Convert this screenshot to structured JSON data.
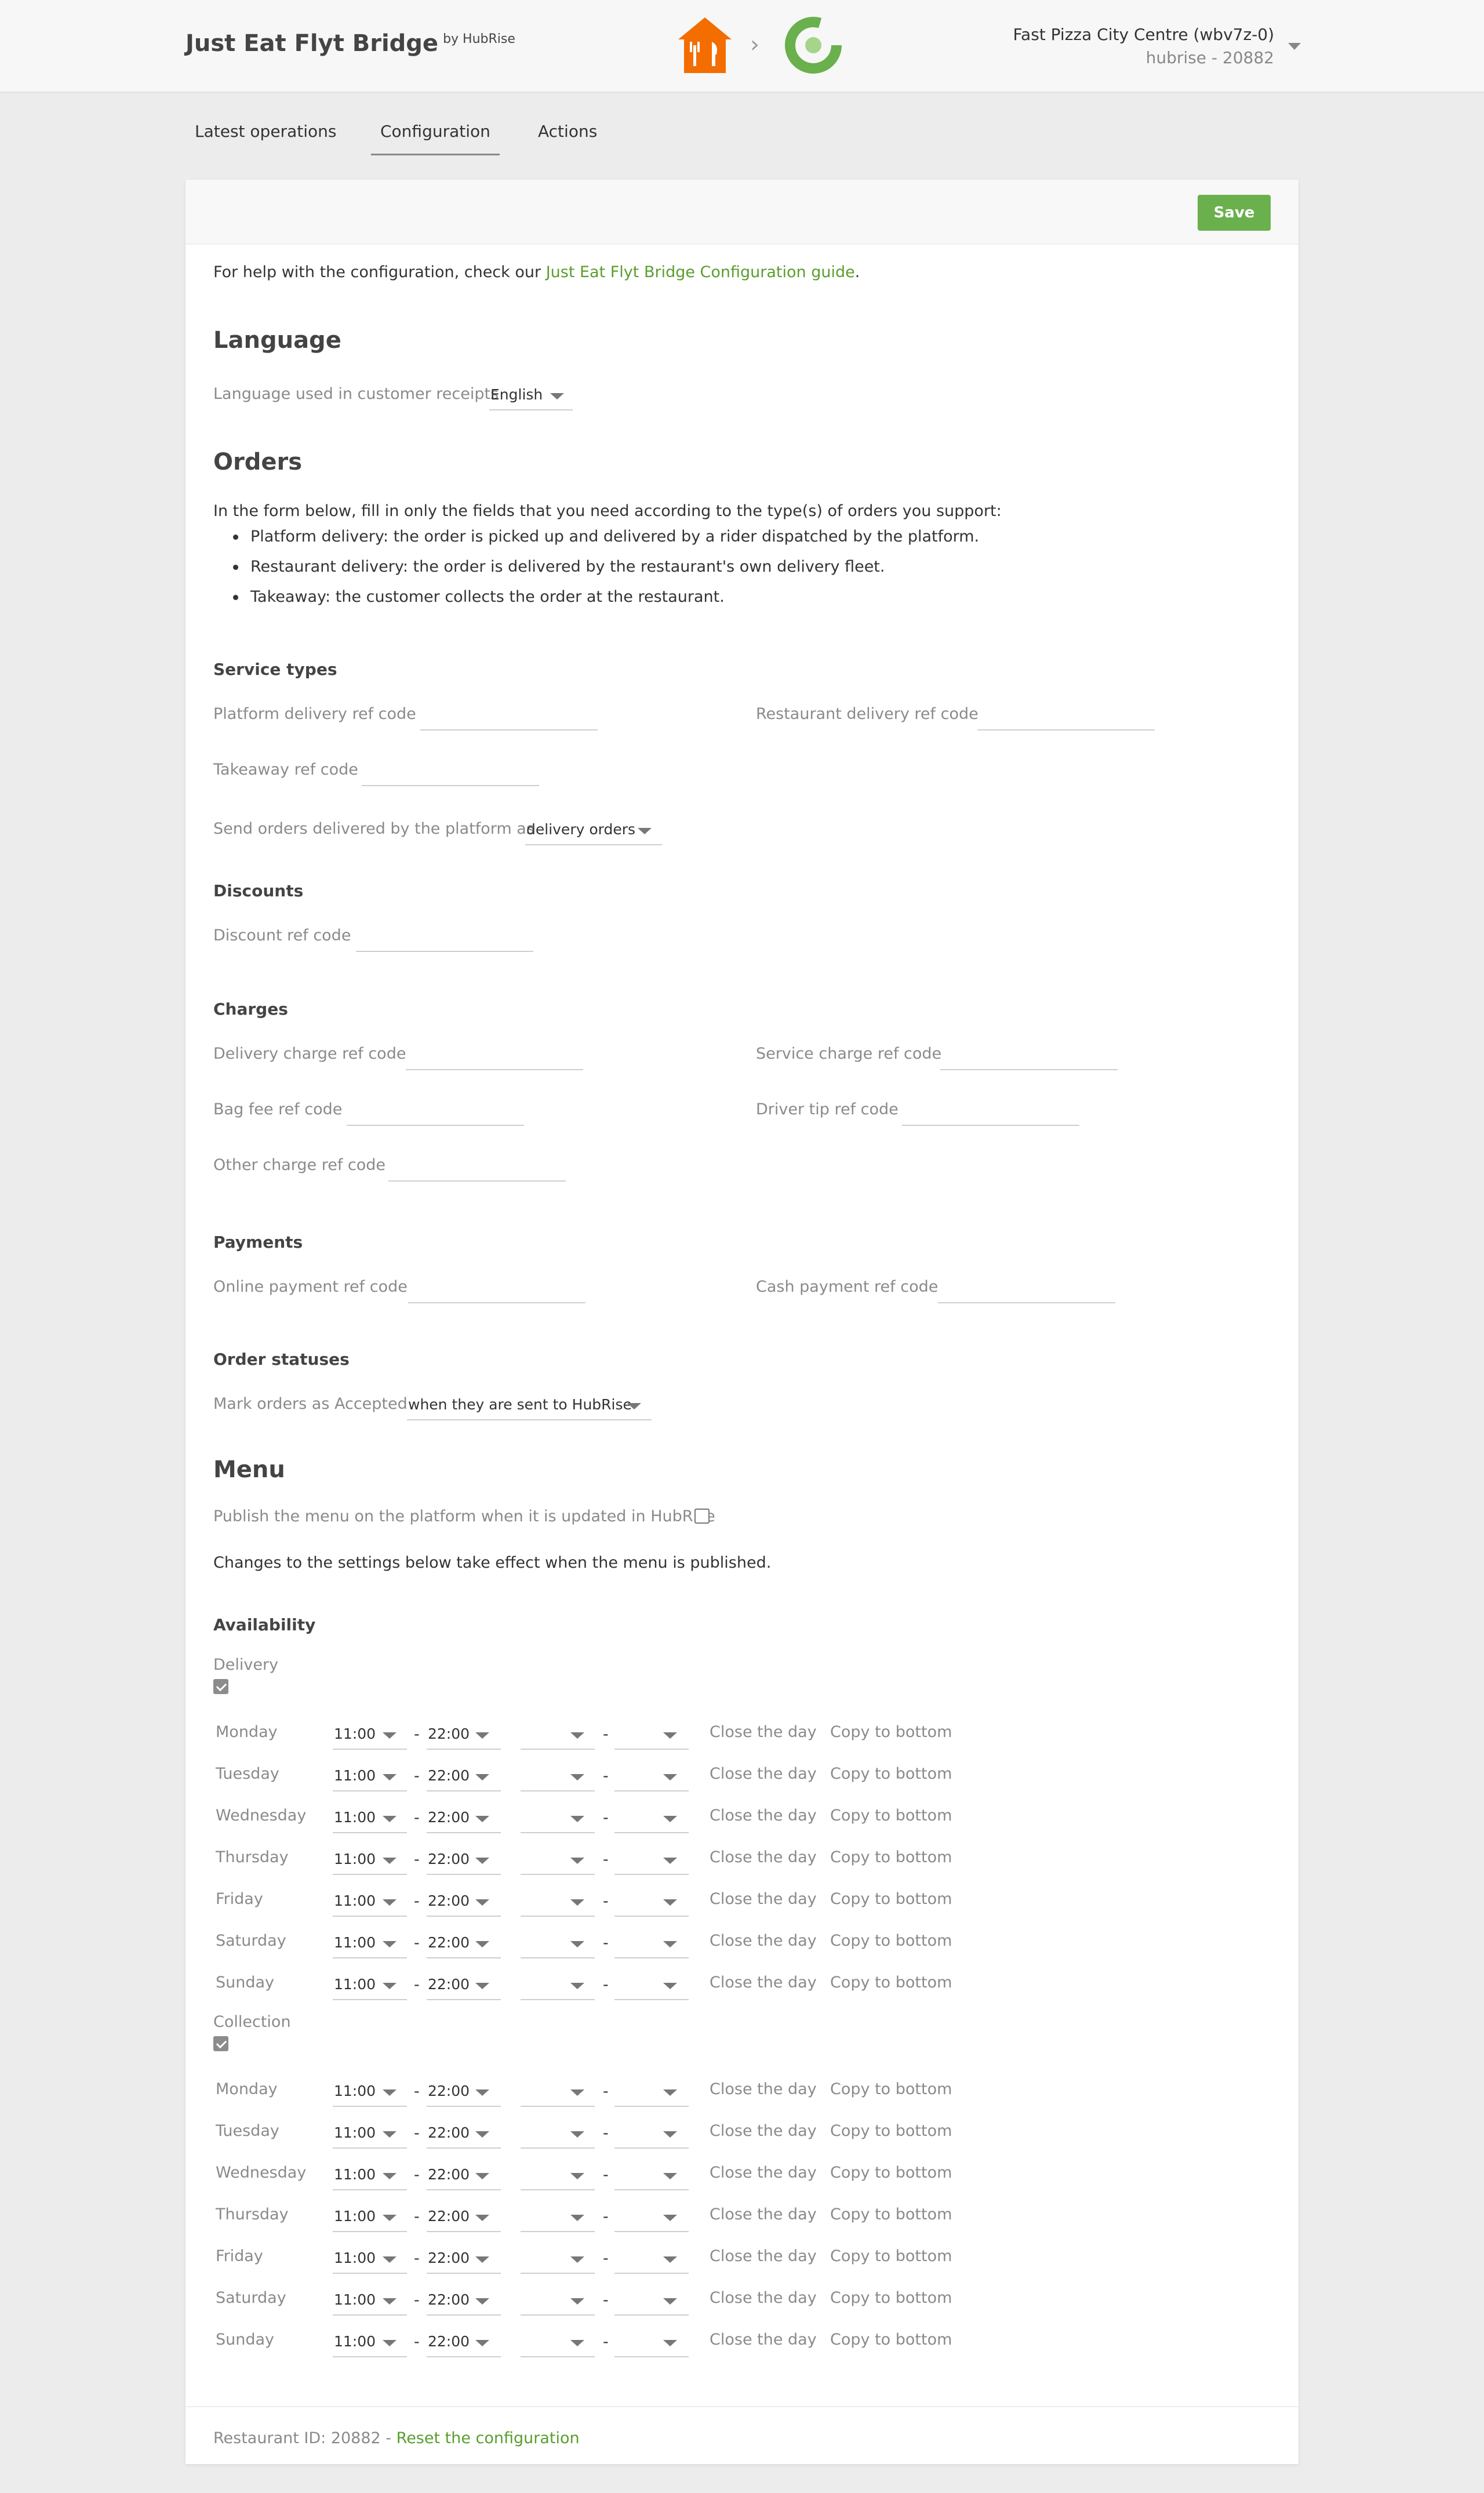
{
  "header": {
    "title": "Just Eat Flyt Bridge",
    "by": "by HubRise",
    "arrow": "›",
    "account_name": "Fast Pizza City Centre (wbv7z-0)",
    "account_sub": "hubrise - 20882",
    "brand_color": "#f36d00",
    "hubrise_color": "#6ab04c"
  },
  "tabs": [
    {
      "label": "Latest operations"
    },
    {
      "label": "Configuration",
      "active": true
    },
    {
      "label": "Actions"
    }
  ],
  "save_label": "Save",
  "help": {
    "prefix": "For help with the configuration, check our ",
    "link": "Just Eat Flyt Bridge Configuration guide",
    "suffix": "."
  },
  "language": {
    "heading": "Language",
    "label": "Language used in customer receipts",
    "value": "English"
  },
  "orders": {
    "heading": "Orders",
    "intro": "In the form below, fill in only the fields that you need according to the type(s) of orders you support:",
    "bullets": [
      "Platform delivery: the order is picked up and delivered by a rider dispatched by the platform.",
      "Restaurant delivery: the order is delivered by the restaurant's own delivery fleet.",
      "Takeaway: the customer collects the order at the restaurant."
    ],
    "service_types": {
      "heading": "Service types",
      "platform_delivery": "Platform delivery ref code",
      "restaurant_delivery": "Restaurant delivery ref code",
      "takeaway": "Takeaway ref code",
      "send_as_label": "Send orders delivered by the platform as",
      "send_as_value": "delivery orders"
    },
    "discounts": {
      "heading": "Discounts",
      "discount": "Discount ref code"
    },
    "charges": {
      "heading": "Charges",
      "delivery": "Delivery charge ref code",
      "service": "Service charge ref code",
      "bag_fee": "Bag fee ref code",
      "driver_tip": "Driver tip ref code",
      "other": "Other charge ref code"
    },
    "payments": {
      "heading": "Payments",
      "online": "Online payment ref code",
      "cash": "Cash payment ref code"
    },
    "statuses": {
      "heading": "Order statuses",
      "label": "Mark orders as Accepted",
      "value": "when they are sent to HubRise"
    }
  },
  "menu": {
    "heading": "Menu",
    "publish_label": "Publish the menu on the platform when it is updated in HubRise",
    "publish_checked": false,
    "note": "Changes to the settings below take effect when the menu is published.",
    "availability_heading": "Availability",
    "close_day": "Close the day",
    "copy_bottom": "Copy to bottom",
    "dash": "-",
    "groups": [
      {
        "label": "Delivery",
        "enabled": true,
        "days": [
          {
            "day": "Monday",
            "open": "11:00",
            "close": "22:00",
            "open2": "",
            "close2": ""
          },
          {
            "day": "Tuesday",
            "open": "11:00",
            "close": "22:00",
            "open2": "",
            "close2": ""
          },
          {
            "day": "Wednesday",
            "open": "11:00",
            "close": "22:00",
            "open2": "",
            "close2": ""
          },
          {
            "day": "Thursday",
            "open": "11:00",
            "close": "22:00",
            "open2": "",
            "close2": ""
          },
          {
            "day": "Friday",
            "open": "11:00",
            "close": "22:00",
            "open2": "",
            "close2": ""
          },
          {
            "day": "Saturday",
            "open": "11:00",
            "close": "22:00",
            "open2": "",
            "close2": ""
          },
          {
            "day": "Sunday",
            "open": "11:00",
            "close": "22:00",
            "open2": "",
            "close2": ""
          }
        ]
      },
      {
        "label": "Collection",
        "enabled": true,
        "days": [
          {
            "day": "Monday",
            "open": "11:00",
            "close": "22:00",
            "open2": "",
            "close2": ""
          },
          {
            "day": "Tuesday",
            "open": "11:00",
            "close": "22:00",
            "open2": "",
            "close2": ""
          },
          {
            "day": "Wednesday",
            "open": "11:00",
            "close": "22:00",
            "open2": "",
            "close2": ""
          },
          {
            "day": "Thursday",
            "open": "11:00",
            "close": "22:00",
            "open2": "",
            "close2": ""
          },
          {
            "day": "Friday",
            "open": "11:00",
            "close": "22:00",
            "open2": "",
            "close2": ""
          },
          {
            "day": "Saturday",
            "open": "11:00",
            "close": "22:00",
            "open2": "",
            "close2": ""
          },
          {
            "day": "Sunday",
            "open": "11:00",
            "close": "22:00",
            "open2": "",
            "close2": ""
          }
        ]
      }
    ]
  },
  "footer": {
    "prefix": "Restaurant ID: 20882 - ",
    "reset_link": "Reset the configuration"
  }
}
